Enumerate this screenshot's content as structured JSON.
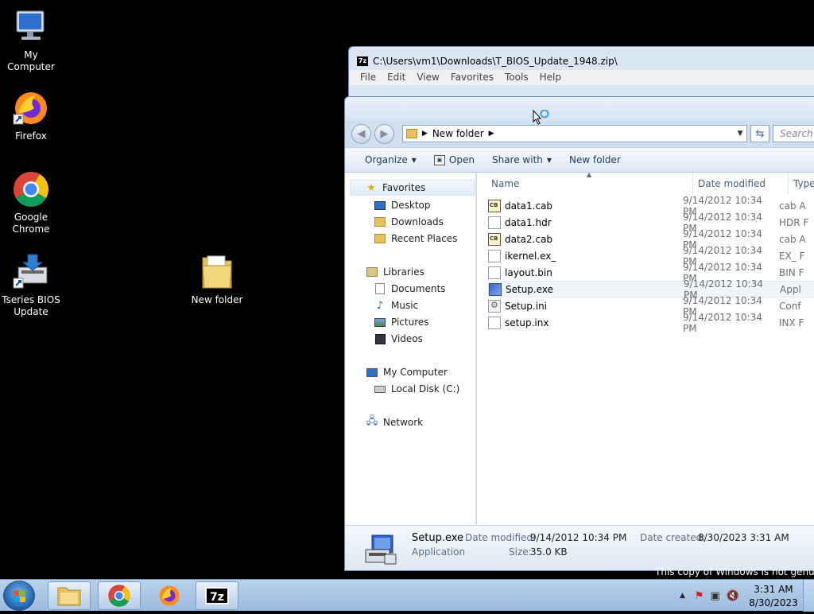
{
  "desktop": {
    "icons": [
      {
        "label": "My Computer"
      },
      {
        "label": "Firefox"
      },
      {
        "label": "Google Chrome"
      },
      {
        "label": "Tseries BIOS Update"
      },
      {
        "label": "New folder"
      }
    ],
    "watermark": "This copy of Windows is not genuine"
  },
  "zip_window": {
    "title": "C:\\Users\\vm1\\Downloads\\T_BIOS_Update_1948.zip\\",
    "menu": [
      "File",
      "Edit",
      "View",
      "Favorites",
      "Tools",
      "Help"
    ]
  },
  "explorer": {
    "breadcrumb": "New folder",
    "search_placeholder": "Search",
    "toolbar": {
      "organize": "Organize",
      "open": "Open",
      "share_with": "Share with",
      "new_folder": "New folder"
    },
    "nav": {
      "favorites": "Favorites",
      "desktop": "Desktop",
      "downloads": "Downloads",
      "recent_places": "Recent Places",
      "libraries": "Libraries",
      "documents": "Documents",
      "music": "Music",
      "pictures": "Pictures",
      "videos": "Videos",
      "my_computer": "My Computer",
      "local_disk": "Local Disk (C:)",
      "network": "Network"
    },
    "columns": {
      "name": "Name",
      "date_modified": "Date modified",
      "type": "Type"
    },
    "files": [
      {
        "name": "data1.cab",
        "date": "9/14/2012 10:34 PM",
        "type": "cab A",
        "icon": "cab-file-icon"
      },
      {
        "name": "data1.hdr",
        "date": "9/14/2012 10:34 PM",
        "type": "HDR F",
        "icon": "file-icon"
      },
      {
        "name": "data2.cab",
        "date": "9/14/2012 10:34 PM",
        "type": "cab A",
        "icon": "cab-file-icon"
      },
      {
        "name": "ikernel.ex_",
        "date": "9/14/2012 10:34 PM",
        "type": "EX_ F",
        "icon": "file-icon"
      },
      {
        "name": "layout.bin",
        "date": "9/14/2012 10:34 PM",
        "type": "BIN F",
        "icon": "file-icon"
      },
      {
        "name": "Setup.exe",
        "date": "9/14/2012 10:34 PM",
        "type": "Appl",
        "icon": "exe-file-icon"
      },
      {
        "name": "Setup.ini",
        "date": "9/14/2012 10:34 PM",
        "type": "Conf",
        "icon": "ini-file-icon"
      },
      {
        "name": "setup.inx",
        "date": "9/14/2012 10:34 PM",
        "type": "INX F",
        "icon": "file-icon"
      }
    ],
    "details": {
      "name": "Setup.exe",
      "kind": "Application",
      "date_modified_label": "Date modified:",
      "date_modified": "9/14/2012 10:34 PM",
      "size_label": "Size:",
      "size": "35.0 KB",
      "date_created_label": "Date created:",
      "date_created": "8/30/2023 3:31 AM"
    }
  },
  "taskbar": {
    "time": "3:31 AM",
    "date": "8/30/2023",
    "sevenzip_label": "7z"
  }
}
